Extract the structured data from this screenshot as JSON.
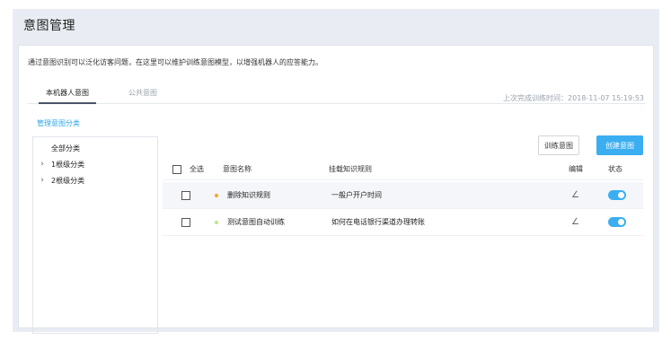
{
  "header": {
    "title": "意图管理"
  },
  "description": "通过意图识别可以泛化访客问题，在这里可以维护训练意图模型，以增强机器人的应答能力。",
  "tabs": [
    {
      "label": "本机器人意图",
      "active": true
    },
    {
      "label": "公共意图",
      "active": false
    }
  ],
  "last_train": "上次完成训练时间：2018-11-07 15:19:53",
  "manage_link": "管理意图分类",
  "tree": {
    "items": [
      {
        "label": "全部分类",
        "expandable": false
      },
      {
        "label": "1根级分类",
        "expandable": true,
        "icon": "chevron-right-icon"
      },
      {
        "label": "2根级分类",
        "expandable": true,
        "icon": "chevron-right-icon"
      }
    ]
  },
  "buttons": {
    "train": "训练意图",
    "create": "创建意图"
  },
  "table": {
    "headers": {
      "select_all": "全选",
      "name": "意图名称",
      "rule": "挂载知识规则",
      "edit": "编辑",
      "status": "状态"
    },
    "rows": [
      {
        "name": "删除知识规则",
        "rule": "一般户开户时间",
        "dot_color": "#f5a623",
        "enabled": true
      },
      {
        "name": "测试意图自动训练",
        "rule": "如何在电话银行渠道办理转账",
        "dot_color": "#b8e986",
        "enabled": true
      }
    ]
  },
  "colors": {
    "accent": "#3aaef0",
    "toggle_on": "#3aaef0",
    "link": "#2fa4e7"
  },
  "icons": {
    "edit": "pencil-icon",
    "expand": "chevron-right-icon"
  }
}
